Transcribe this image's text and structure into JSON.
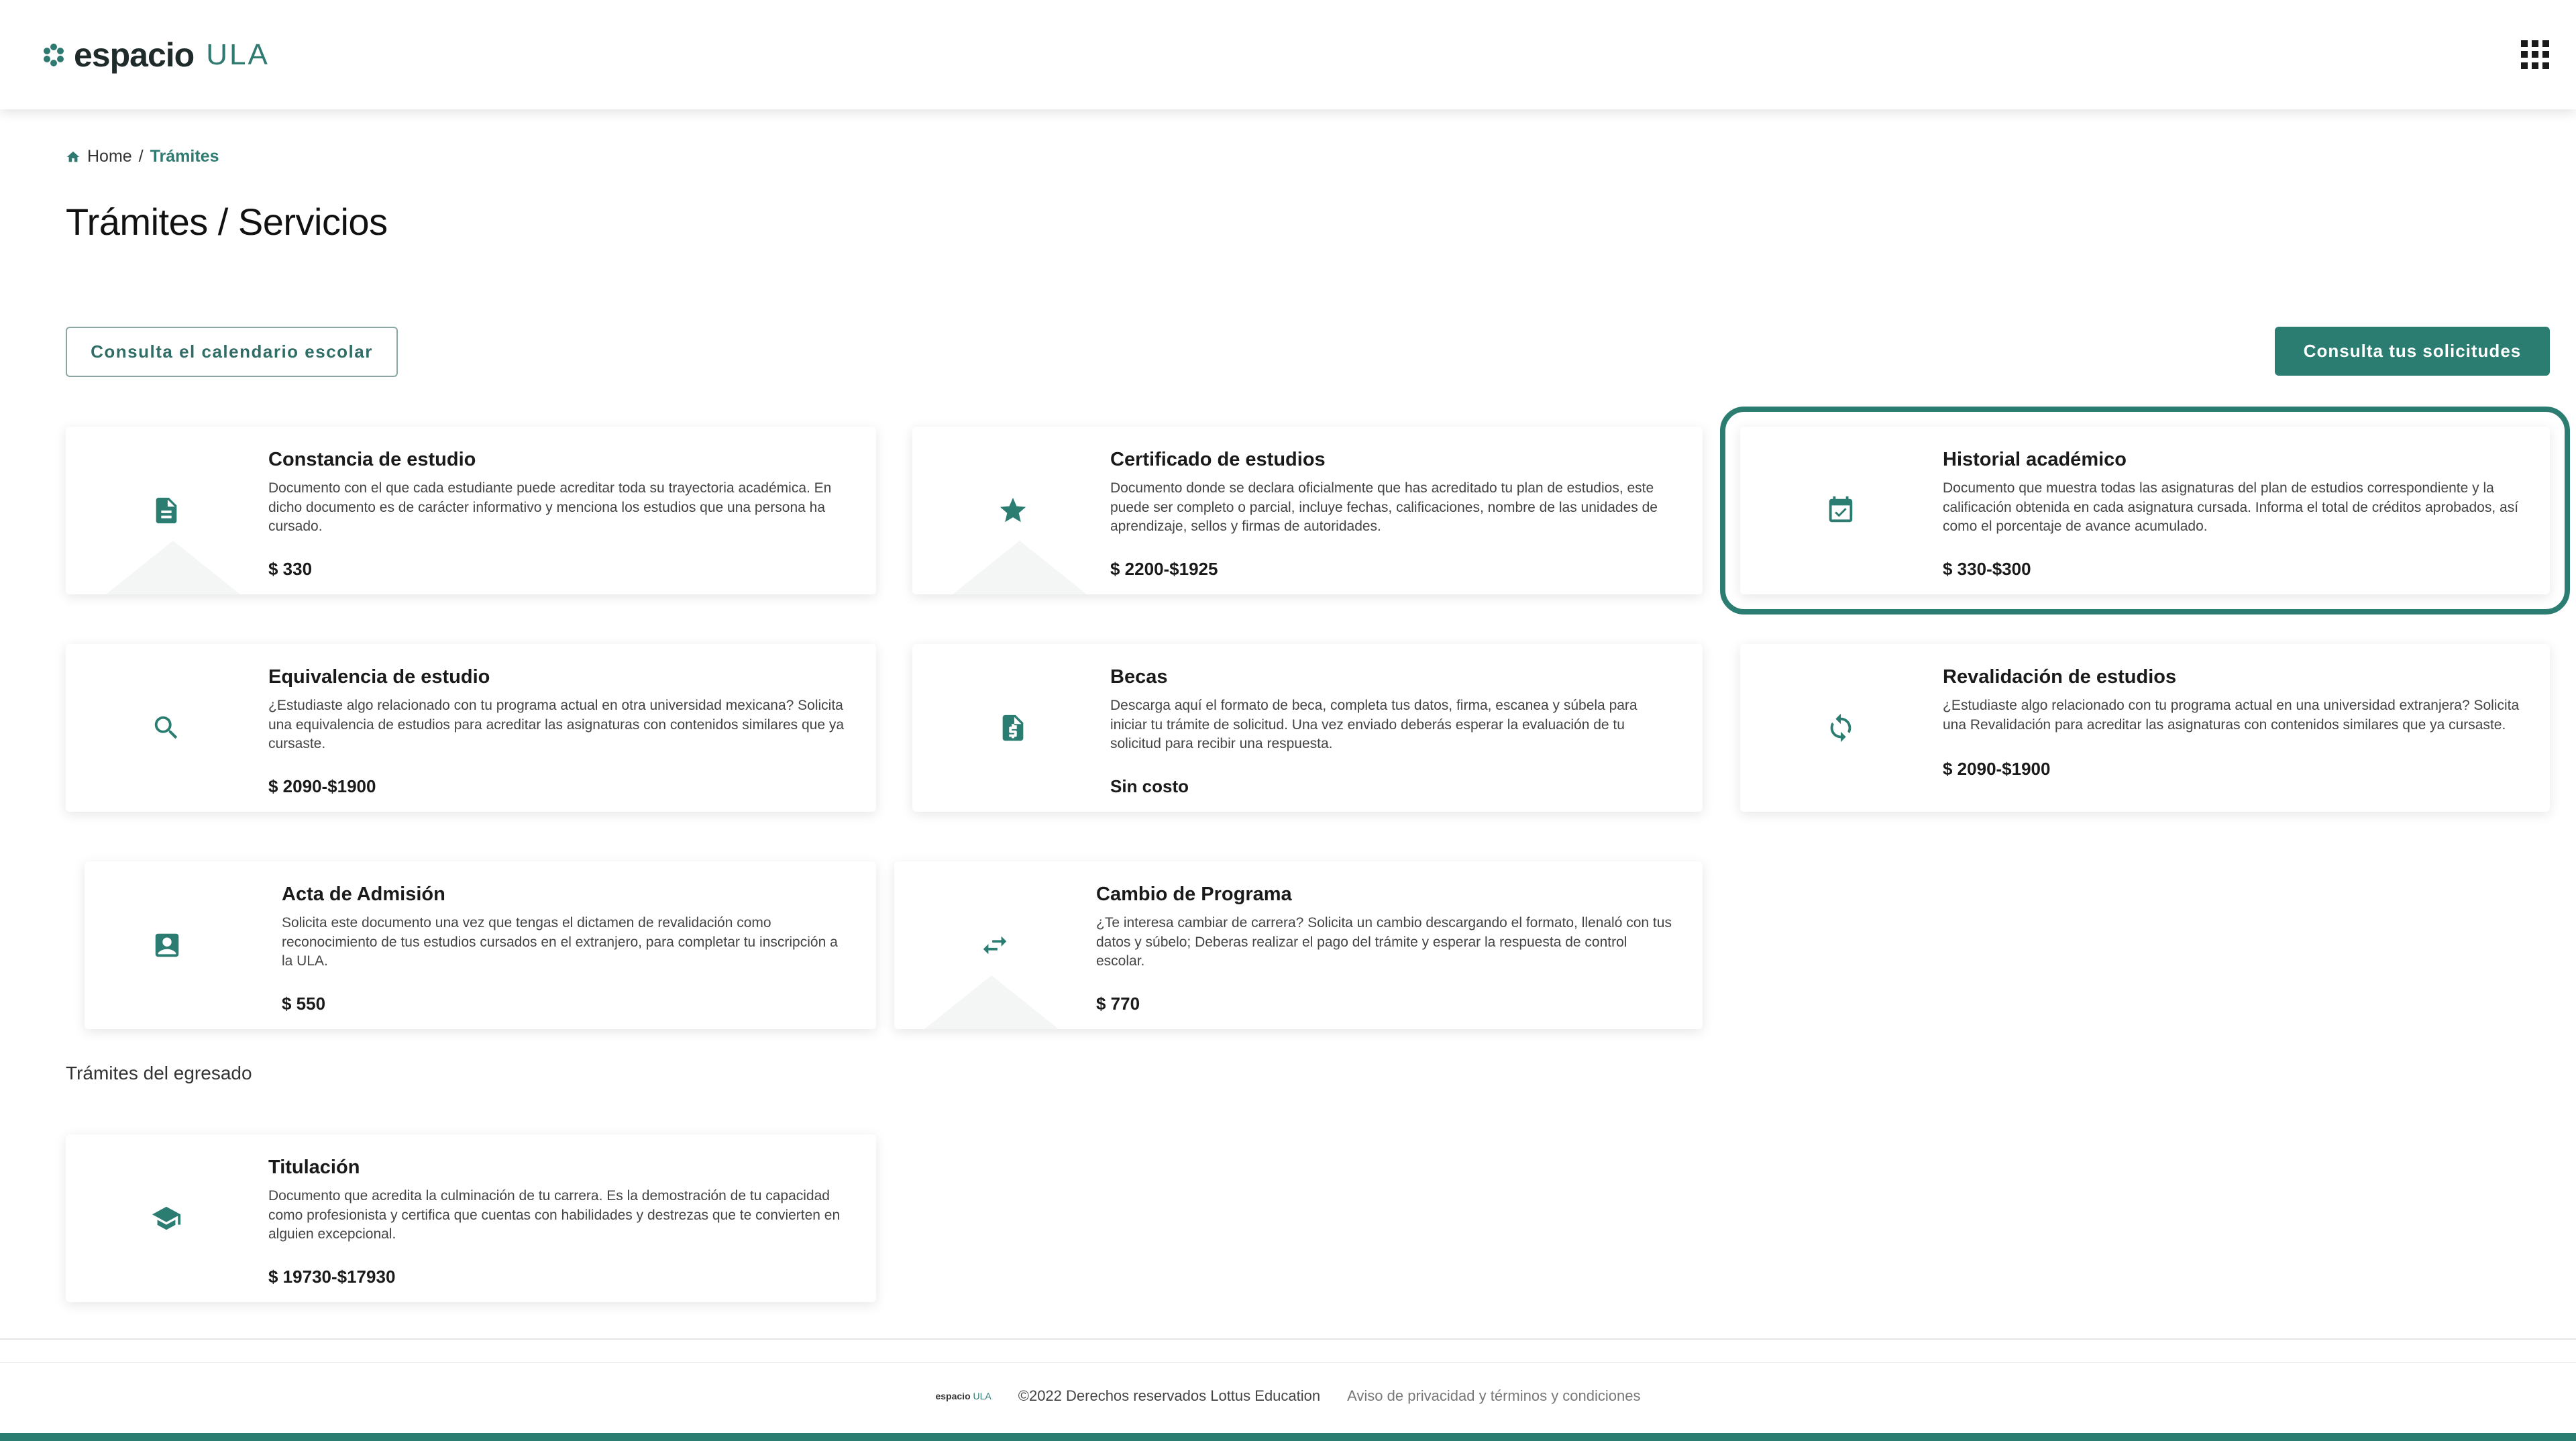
{
  "header": {
    "logo_main": "espacio",
    "logo_sub": "ULA",
    "apps_icon": "grid-apps-icon"
  },
  "breadcrumb": {
    "home": "Home",
    "separator": "/",
    "current": "Trámites"
  },
  "page_title": "Trámites / Servicios",
  "actions": {
    "calendar_button": "Consulta el calendario escolar",
    "requests_button": "Consulta tus solicitudes"
  },
  "cards": [
    {
      "title": "Constancia de estudio",
      "description": "Documento con el que cada estudiante puede acreditar toda su trayectoria académica. En dicho documento es de carácter informativo y menciona los estudios que una persona ha cursado.",
      "price": "$ 330",
      "icon": "document-icon"
    },
    {
      "title": "Certificado de estudios",
      "description": "Documento donde se declara oficialmente que has acreditado tu plan de estudios, este puede ser completo o parcial, incluye fechas, calificaciones, nombre de las unidades de aprendizaje, sellos y firmas de autoridades.",
      "price": "$ 2200-$1925",
      "icon": "star-icon"
    },
    {
      "title": "Historial académico",
      "description": "Documento que muestra todas las asignaturas del plan de estudios correspondiente y la calificación obtenida en cada asignatura cursada. Informa el total de créditos aprobados, así como el porcentaje de avance acumulado.",
      "price": "$ 330-$300",
      "icon": "calendar-check-icon"
    },
    {
      "title": "Equivalencia de estudio",
      "description": "¿Estudiaste algo relacionado con tu programa actual en otra universidad mexicana? Solicita una equivalencia de estudios para acreditar las asignaturas con contenidos similares que ya cursaste.",
      "price": "$ 2090-$1900",
      "icon": "search-icon"
    },
    {
      "title": "Becas",
      "description": "Descarga aquí el formato de beca, completa tus datos, firma, escanea y súbela para iniciar tu trámite de solicitud. Una vez enviado deberás esperar la evaluación de tu solicitud para recibir una respuesta.",
      "price": "Sin costo",
      "icon": "money-document-icon"
    },
    {
      "title": "Revalidación de estudios",
      "description": "¿Estudiaste algo relacionado con tu programa actual en una universidad extranjera? Solicita una Revalidación para acreditar las asignaturas con contenidos similares que ya cursaste.",
      "price": "$ 2090-$1900",
      "icon": "sync-icon"
    },
    {
      "title": "Acta de Admisión",
      "description": "Solicita este documento una vez que tengas el dictamen de revalidación como reconocimiento de tus estudios cursados en el extranjero, para completar tu inscripción a la ULA.",
      "price": "$ 550",
      "icon": "id-badge-icon"
    },
    {
      "title": "Cambio de Programa",
      "description": "¿Te interesa cambiar de carrera? Solicita un cambio descargando el formato, llenaló con tus datos y súbelo; Deberas realizar el pago del trámite y esperar la respuesta de control escolar.",
      "price": "$ 770",
      "icon": "swap-arrows-icon"
    },
    {
      "title": "Titulación",
      "description": "Documento que acredita la culminación de tu carrera. Es la demostración de tu capacidad como profesionista y certifica que cuentas con habilidades y destrezas que te convierten en alguien excepcional.",
      "price": "$ 19730-$17930",
      "icon": "graduation-cap-icon"
    }
  ],
  "graduate_section_label": "Trámites del egresado",
  "footer": {
    "mini_logo_main": "espacio",
    "mini_logo_sub": "ULA",
    "copyright": "©2022 Derechos reservados Lottus Education",
    "privacy_link": "Aviso de privacidad y términos y condiciones"
  },
  "colors": {
    "accent": "#2b7d72",
    "text": "#1a1a1a"
  }
}
